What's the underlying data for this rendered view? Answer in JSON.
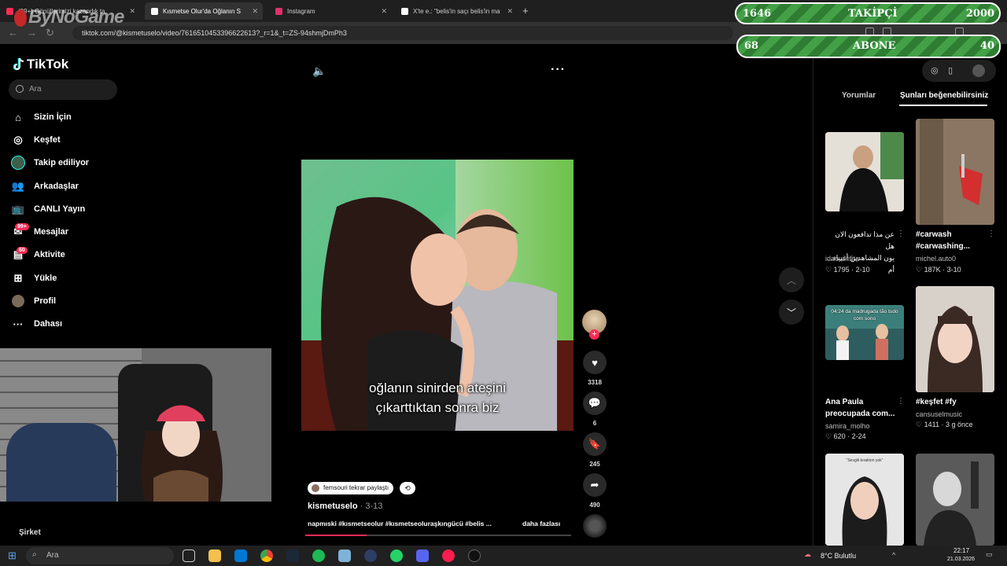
{
  "browser": {
    "tabs": [
      {
        "label": "(99+) Gönüllerimizi kazandık ta",
        "color": "#fe2c55"
      },
      {
        "label": "Kısmetse Olur'da Oğlanın S",
        "color": "#ffffff"
      },
      {
        "label": "Instagram",
        "color": "#e1306c"
      },
      {
        "label": "X'te e.: \"belis'in saçı belis'in ma",
        "color": "#ffffff"
      }
    ],
    "url": "tiktok.com/@kismetuselo/video/7616510453396622613?_r=1&_t=ZS-94shmjDmPh3"
  },
  "watermark": "ByNoGame",
  "counters": {
    "followers": {
      "label": "TAKİPÇİ",
      "current": "1646",
      "goal": "2000"
    },
    "subscribers": {
      "label": "ABONE",
      "current": "68",
      "goal": "40"
    }
  },
  "sidebar": {
    "logo": "TikTok",
    "search_placeholder": "Ara",
    "items": [
      {
        "label": "Sizin İçin",
        "icon": "home-icon"
      },
      {
        "label": "Keşfet",
        "icon": "compass-icon"
      },
      {
        "label": "Takip ediliyor",
        "icon": "following-avatar-icon"
      },
      {
        "label": "Arkadaşlar",
        "icon": "friends-icon"
      },
      {
        "label": "CANLI Yayın",
        "icon": "live-tv-icon"
      },
      {
        "label": "Mesajlar",
        "icon": "messages-icon",
        "badge": "99+"
      },
      {
        "label": "Aktivite",
        "icon": "activity-icon",
        "badge": "60"
      },
      {
        "label": "Yükle",
        "icon": "upload-icon"
      },
      {
        "label": "Profil",
        "icon": "profile-icon"
      },
      {
        "label": "Dahası",
        "icon": "more-icon"
      }
    ],
    "footer_heading": "Şirket"
  },
  "video": {
    "caption_line1": "oğlanın sinirden ateşini",
    "caption_line2": "çıkarttıktan sonra biz",
    "progress": 0.23
  },
  "actions": {
    "likes": "3318",
    "comments": "6",
    "saves": "245",
    "shares": "490"
  },
  "meta": {
    "repost_label": "femsouri tekrar paylaştı",
    "author": "kismetuselo",
    "date": "3-13",
    "description": "napmıski #kısmetseolur #kısmetseoluraşkıngücü #belis ...",
    "more_label": "daha fazlası"
  },
  "right_panel": {
    "tabs": [
      "Yorumlar",
      "Şunları beğenebilirsiniz"
    ],
    "active_tab": 1,
    "cards": [
      {
        "title_line1": "عن مذا تدافعون الان هل",
        "title_line2": "...يون المشاهدين أغبياء أم",
        "user": "idaousfifita",
        "likes": "1795",
        "date": "2-10",
        "rtl": true
      },
      {
        "title_line1": "#carwash",
        "title_line2": "#carwashing...",
        "user": "michel.auto0",
        "likes": "187K",
        "date": "3-10"
      },
      {
        "title_line1": "Ana Paula",
        "title_line2": "preocupada com...",
        "user": "samira_molho",
        "likes": "620",
        "date": "2-24",
        "overlay": "04:24 da madrugada tão tudo com sono"
      },
      {
        "title_line1": "#keşfet #fy",
        "title_line2": "",
        "user": "cansuselmusic",
        "likes": "1411",
        "date": "3 g önce"
      },
      {
        "title_line1": "",
        "title_line2": "",
        "user": "",
        "likes": "",
        "date": "",
        "overlay": "\"Sevgili bıraktım yok\""
      },
      {
        "title_line1": "",
        "title_line2": "",
        "user": "",
        "likes": "",
        "date": ""
      }
    ]
  },
  "taskbar": {
    "search_placeholder": "Ara",
    "weather": "8°C  Bulutlu",
    "time": "22:17",
    "date": "21.03.2026"
  }
}
